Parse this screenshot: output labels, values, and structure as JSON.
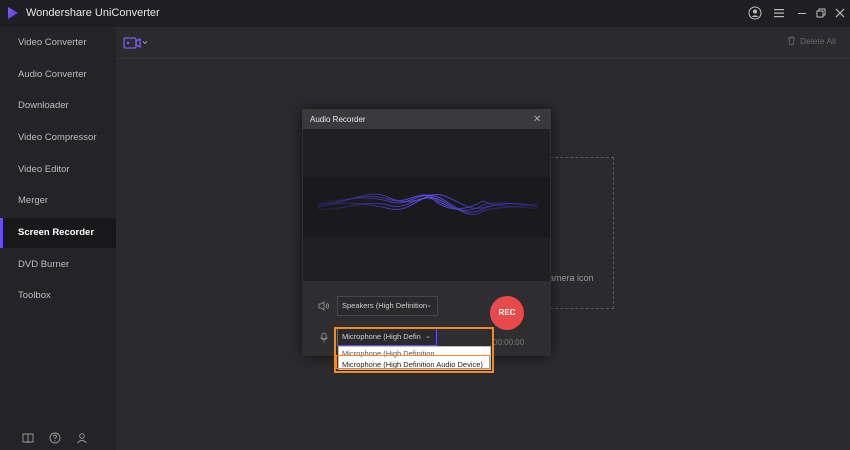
{
  "app": {
    "title": "Wondershare UniConverter"
  },
  "sidebar": {
    "items": [
      {
        "label": "Video Converter"
      },
      {
        "label": "Audio Converter"
      },
      {
        "label": "Downloader"
      },
      {
        "label": "Video Compressor"
      },
      {
        "label": "Video Editor"
      },
      {
        "label": "Merger"
      },
      {
        "label": "Screen Recorder",
        "active": true
      },
      {
        "label": "DVD Burner"
      },
      {
        "label": "Toolbox"
      }
    ]
  },
  "toolbar": {
    "delete_all": "Delete All"
  },
  "main": {
    "drop_hint_partial": "n camera icon"
  },
  "dialog": {
    "title": "Audio Recorder",
    "speaker_value": "Speakers (High Definition",
    "mic_value": "Microphone (High Defin",
    "rec_label": "REC",
    "timer": "00:00:00",
    "mic_options": [
      "Microphone (High Definition",
      "Microphone (High Definition Audio Device)"
    ]
  },
  "colors": {
    "accent": "#6b4df0",
    "rec": "#e8494b",
    "highlight": "#f28a22"
  },
  "icons": [
    "app-logo-icon",
    "user-icon",
    "menu-icon",
    "minimize-icon",
    "restore-icon",
    "close-icon",
    "video-camera-icon",
    "chevron-down-icon",
    "trash-icon",
    "speaker-icon",
    "microphone-icon",
    "book-icon",
    "help-icon",
    "account-icon"
  ]
}
